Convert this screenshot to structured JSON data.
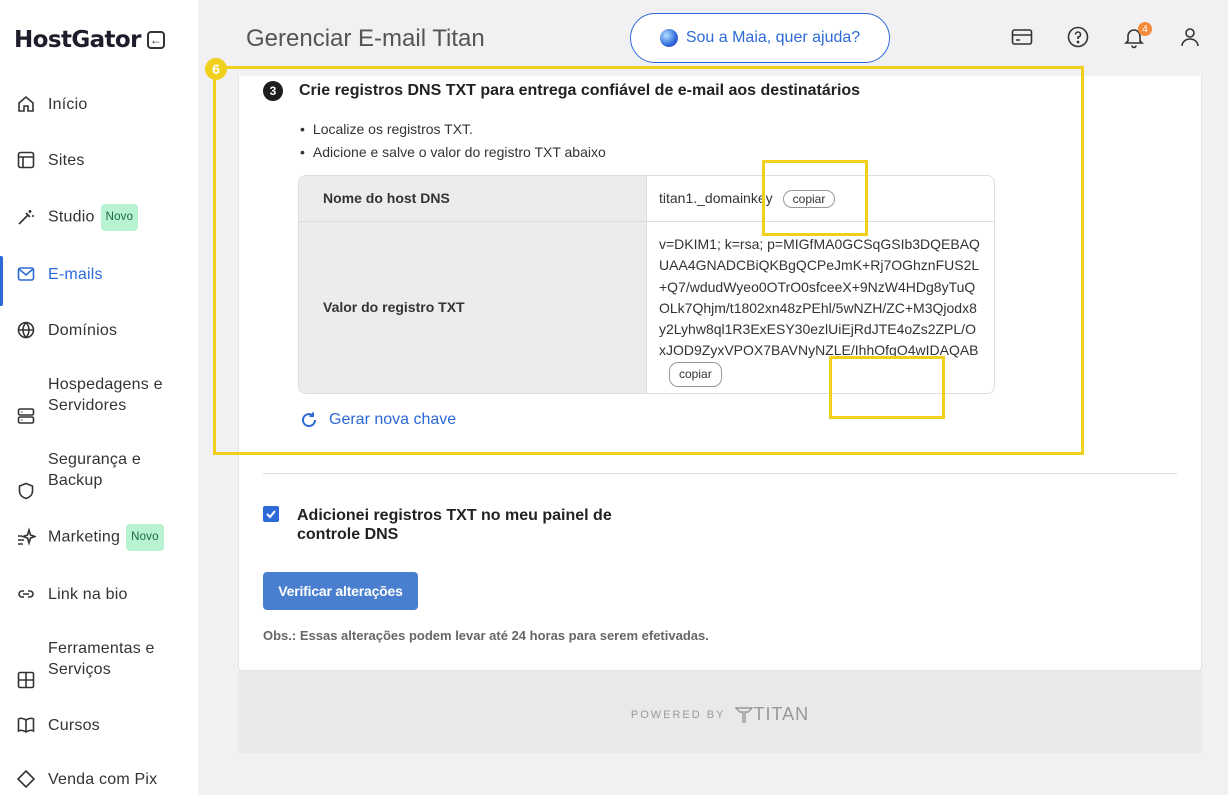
{
  "brand": {
    "logo": "HostGator"
  },
  "sidebar": {
    "items": [
      {
        "label": "Início",
        "icon": "home-icon"
      },
      {
        "label": "Sites",
        "icon": "layout-icon"
      },
      {
        "label": "Studio",
        "icon": "magic-wand-icon",
        "badge": "Novo"
      },
      {
        "label": "E-mails",
        "icon": "mail-icon",
        "active": true
      },
      {
        "label": "Domínios",
        "icon": "globe-icon"
      },
      {
        "label": "Hospedagens e Servidores",
        "line1": "Hospedagens e",
        "line2": "Servidores",
        "icon": "server-icon"
      },
      {
        "label": "Segurança e Backup",
        "line1": "Segurança e",
        "line2": "Backup",
        "icon": "shield-icon"
      },
      {
        "label": "Marketing",
        "icon": "sparkle-icon",
        "badge": "Novo"
      },
      {
        "label": "Link na bio",
        "icon": "link-icon"
      },
      {
        "label": "Ferramentas e Serviços",
        "line1": "Ferramentas e",
        "line2": "Serviços",
        "icon": "tools-icon"
      },
      {
        "label": "Cursos",
        "icon": "book-icon"
      },
      {
        "label": "Venda com Pix",
        "icon": "pix-icon"
      }
    ]
  },
  "header": {
    "title": "Gerenciar E-mail Titan",
    "maia_button": "Sou a Maia, quer ajuda?",
    "notifications_count": "4"
  },
  "step": {
    "number": "3",
    "title": "Crie registros DNS TXT para entrega confiável de e-mail aos destinatários",
    "bullets": [
      "Localize os registros TXT.",
      "Adicione e salve o valor do registro TXT abaixo"
    ]
  },
  "dns_table": {
    "host_label": "Nome do host DNS",
    "host_value": "titan1._domainkey",
    "txt_label": "Valor do registro TXT",
    "txt_value": "v=DKIM1; k=rsa; p=MIGfMA0GCSqGSIb3DQEBAQUAA4GNADCBiQKBgQCPeJmK+Rj7OGhznFUS2L+Q7/wdudWyeo0OTrO0sfceeX+9NzW4HDg8yTuQOLk7Qhjm/t1802xn48zPEhl/5wNZH/ZC+M3Qjodx8y2Lyhw8ql1R3ExESY30ezlUiEjRdJTE4oZs2ZPL/OxJOD9ZyxVPOX7BAVNyNZLE/IhhOfgO4wIDAQAB",
    "copy_label": "copiar"
  },
  "regenerate_label": "Gerar nova chave",
  "confirm_checkbox": {
    "label": "Adicionei registros TXT no meu painel de controle DNS",
    "checked": true
  },
  "verify_button": "Verificar alterações",
  "note": "Obs.: Essas alterações podem levar até 24 horas para serem efetivadas.",
  "footer": {
    "powered_by": "POWERED BY",
    "brand": "TITAN"
  },
  "annotation": {
    "number": "6",
    "color": "#f0cf1d"
  },
  "colors": {
    "accent": "#2d6ad8",
    "badge_bg": "#b7f2d1",
    "notif": "#f48a3a"
  }
}
